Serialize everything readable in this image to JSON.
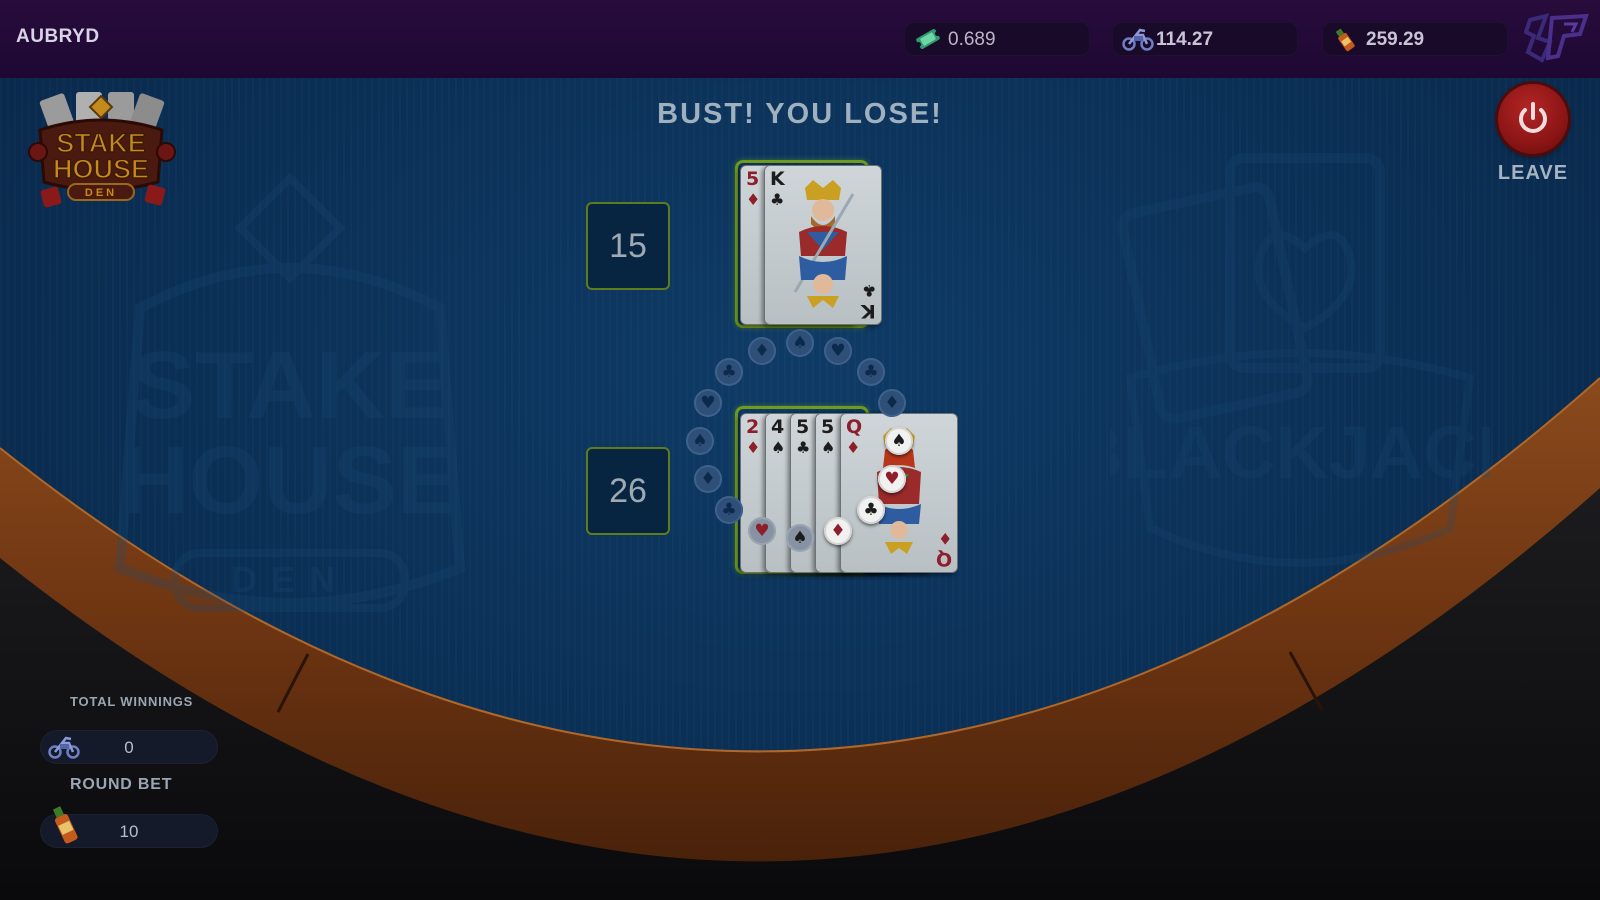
{
  "header": {
    "username": "AUBRYD",
    "balances": [
      {
        "icon": "ticket-icon",
        "value": "0.689"
      },
      {
        "icon": "motorcycle-icon",
        "value": "114.27"
      },
      {
        "icon": "bottle-icon",
        "value": "259.29"
      }
    ],
    "brand_icon": "game-logo-icon"
  },
  "table": {
    "logo_text": [
      "STAKE",
      "HOUSE",
      "DEN"
    ],
    "result_text": "BUST! YOU LOSE!",
    "leave_label": "LEAVE",
    "dealer": {
      "score": "15",
      "cards": [
        {
          "rank": "5",
          "suit": "♦",
          "color": "red"
        },
        {
          "rank": "K",
          "suit": "♣",
          "color": "black"
        }
      ]
    },
    "player": {
      "score": "26",
      "cards": [
        {
          "rank": "2",
          "suit": "♦",
          "color": "red"
        },
        {
          "rank": "4",
          "suit": "♠",
          "color": "black"
        },
        {
          "rank": "5",
          "suit": "♣",
          "color": "black"
        },
        {
          "rank": "5",
          "suit": "♠",
          "color": "black"
        },
        {
          "rank": "Q",
          "suit": "♦",
          "color": "red"
        }
      ]
    }
  },
  "stats": {
    "total_winnings_label": "TOTAL WINNINGS",
    "total_winnings_value": "0",
    "round_bet_label": "ROUND BET",
    "round_bet_value": "10"
  },
  "colors": {
    "topbar": "#280c3c",
    "felt": "#0b3158",
    "accent_green": "#6f9a1a",
    "wood": "#7a3d15",
    "leave_red": "#a01c1c"
  }
}
